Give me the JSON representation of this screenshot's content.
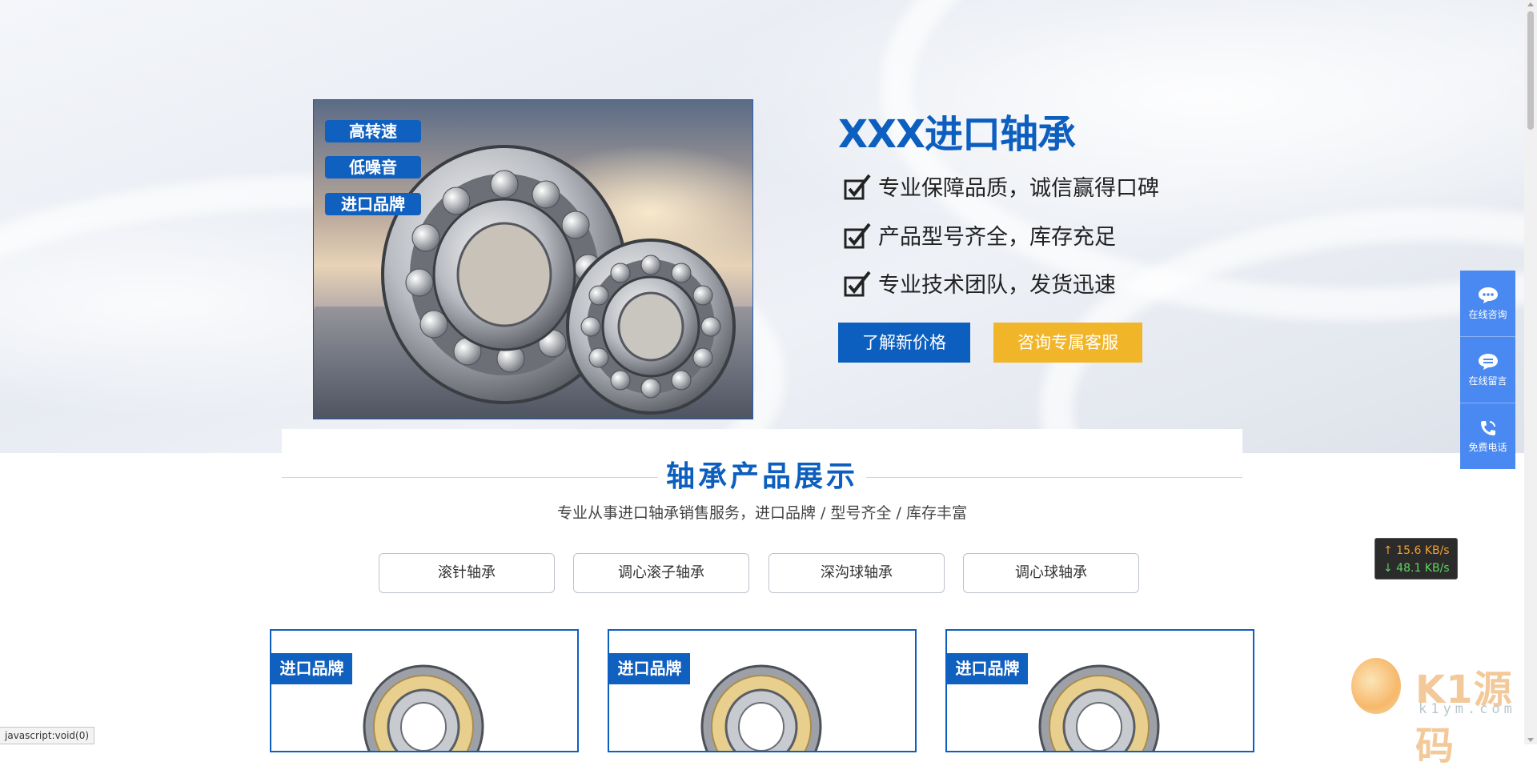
{
  "hero": {
    "tags": [
      "高转速",
      "低噪音",
      "进口品牌"
    ],
    "title": "XXX进口轴承",
    "features": [
      "专业保障品质，诚信赢得口碑",
      "产品型号齐全，库存充足",
      "专业技术团队，发货迅速"
    ],
    "btn_price": "了解新价格",
    "btn_service": "咨询专属客服"
  },
  "section": {
    "title": "轴承产品展示",
    "subtitle": "专业从事进口轴承销售服务，进口品牌 / 型号齐全 / 库存丰富",
    "categories": [
      "滚针轴承",
      "调心滚子轴承",
      "深沟球轴承",
      "调心球轴承"
    ]
  },
  "products": [
    {
      "tag": "进口品牌"
    },
    {
      "tag": "进口品牌"
    },
    {
      "tag": "进口品牌"
    }
  ],
  "float_bar": {
    "items": [
      {
        "label": "在线咨询",
        "icon": "chat-bubble-icon"
      },
      {
        "label": "在线留言",
        "icon": "message-icon"
      },
      {
        "label": "免费电话",
        "icon": "phone-icon"
      }
    ]
  },
  "speed_widget": {
    "up": "↑ 15.6 KB/s",
    "down": "↓ 48.1 KB/s"
  },
  "watermark": {
    "text": "K1源码",
    "url": "k1ym.com"
  },
  "status_bar": {
    "text": "javascript:void(0)"
  },
  "colors": {
    "brand_blue": "#0d5fbf",
    "accent_yellow": "#f1b52a",
    "float_blue": "#4a89f1"
  }
}
